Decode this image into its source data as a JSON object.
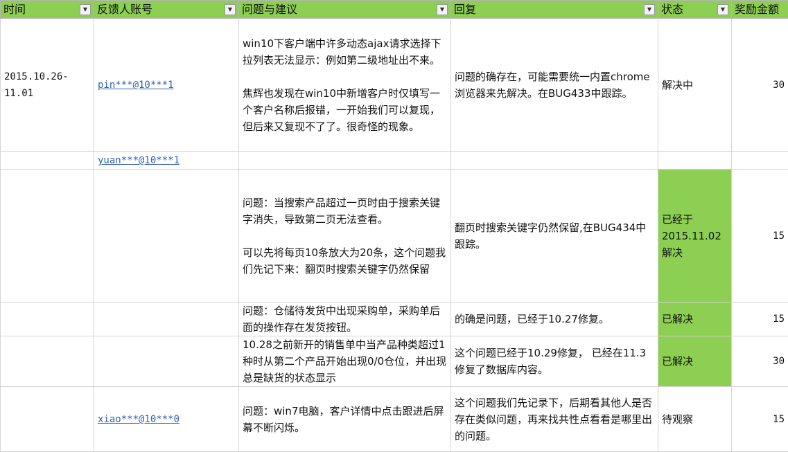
{
  "headers": [
    {
      "label": "时间"
    },
    {
      "label": "反馈人账号"
    },
    {
      "label": "问题与建议"
    },
    {
      "label": "回复"
    },
    {
      "label": "状态"
    },
    {
      "label": "奖励金额"
    }
  ],
  "rows": [
    {
      "time": "2015.10.26-\n11.01",
      "account": "pin***@10***1",
      "issue_p1": " win10下客户端中许多动态ajax请求选择下拉列表无法显示：例如第二级地址出不来。",
      "issue_p2": "焦辉也发现在win10中新增客户时仅填写一个客户名称后报错，一开始我们可以复现，但后来又复现不了了。很奇怪的现象。",
      "reply": "问题的确存在，可能需要统一内置chrome浏览器来先解决。在BUG433中跟踪。",
      "status": "解决中",
      "reward": "30"
    },
    {
      "account": "yuan***@10***1"
    },
    {
      "issue_p1": "问题：当搜索产品超过一页时由于搜索关键字消失，导致第二页无法查看。",
      "issue_p2": "可以先将每页10条放大为20条，这个问题我们先记下来：翻页时搜索关键字仍然保留",
      "reply": "翻页时搜索关键字仍然保留,在BUG434中跟踪。",
      "status": "已经于\n2015.11.02\n解决",
      "reward": "15"
    },
    {
      "issue": "问题：仓储待发货中出现采购单，采购单后面的操作存在发货按钮。",
      "reply": "的确是问题，已经于10.27修复。",
      "status": "已解决",
      "reward": "15"
    },
    {
      "issue": "10.28之前新开的销售单中当产品种类超过1种时从第二个产品开始出现0/0仓位，并出现总是缺货的状态显示",
      "reply": "这个问题已经于10.29修复， 已经在11.3修复了数据库内容。",
      "status": "已解决",
      "reward": "30"
    },
    {
      "account": "xiao***@10***0",
      "issue": "问题：win7电脑，客户详情中点击跟进后屏幕不断闪烁。",
      "reply": "这个问题我们先记录下，后期看其他人是否存在类似问题，再来找共性点看看是哪里出的问题。",
      "status": "待观察",
      "reward": "15"
    }
  ],
  "colors": {
    "header_bg": "#8ccf52",
    "status_highlight": "#8ccf52",
    "link": "#2f5fb5"
  },
  "icons": {
    "filter": "dropdown-filter-icon"
  }
}
